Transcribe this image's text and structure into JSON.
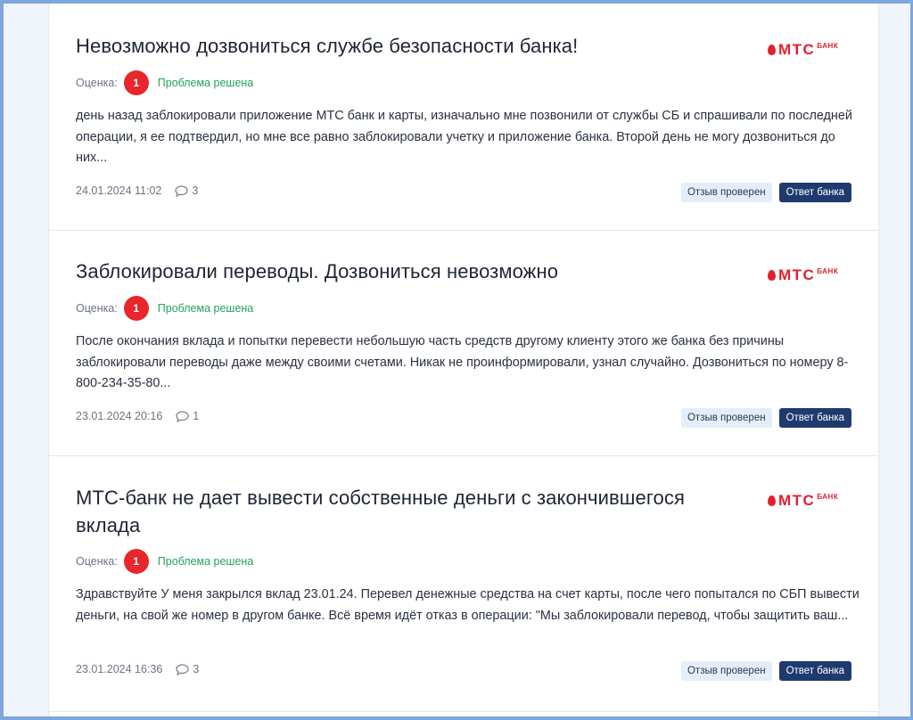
{
  "reviews": [
    {
      "title": "Невозможно дозвониться службе безопасности банка!",
      "logo": {
        "brand": "МТС",
        "sub": "БАНК"
      },
      "rating_label": "Оценка:",
      "score": "1",
      "status": "Проблема решена",
      "text": "день назад заблокировали приложение МТС банк и карты, изначально мне позвонили от службы СБ и спрашивали по последней операции, я ее подтвердил, но мне все равно заблокировали учетку и приложение банка. Второй день не могу дозвониться до них...",
      "date": "24.01.2024 11:02",
      "comments": "3",
      "badge_verified": "Отзыв проверен",
      "badge_answer": "Ответ банка"
    },
    {
      "title": "Заблокировали переводы. Дозвониться невозможно",
      "logo": {
        "brand": "МТС",
        "sub": "БАНК"
      },
      "rating_label": "Оценка:",
      "score": "1",
      "status": "Проблема решена",
      "text": "После окончания вклада и попытки перевести небольшую часть средств другому клиенту этого же банка без причины заблокировали переводы даже между своими счетами. Никак не проинформировали, узнал случайно. Дозвониться по номеру 8-800-234-35-80...",
      "date": "23.01.2024 20:16",
      "comments": "1",
      "badge_verified": "Отзыв проверен",
      "badge_answer": "Ответ банка"
    },
    {
      "title": "МТС-банк не дает вывести собственные деньги с закончившегося вклада",
      "logo": {
        "brand": "МТС",
        "sub": "БАНК"
      },
      "rating_label": "Оценка:",
      "score": "1",
      "status": "Проблема решена",
      "text": "Здравствуйте У меня закрылся вклад 23.01.24. Перевел денежные средства на счет карты, после чего попытался по СБП вывести деньги, на свой же номер в другом банке. Всё время идёт отказ в операции: \"Мы заблокировали перевод, чтобы защитить ваш...",
      "date": "23.01.2024 16:36",
      "comments": "3",
      "badge_verified": "Отзыв проверен",
      "badge_answer": "Ответ банка"
    }
  ],
  "colors": {
    "score_bg": "#e8262b",
    "status_green": "#22a35a",
    "answer_badge": "#1f3a6e",
    "verified_badge": "#e3eefa",
    "brand_red": "#e41f2d"
  },
  "icons": {
    "comment": "speech-bubble-icon",
    "logo_mark": "mts-egg-icon"
  }
}
